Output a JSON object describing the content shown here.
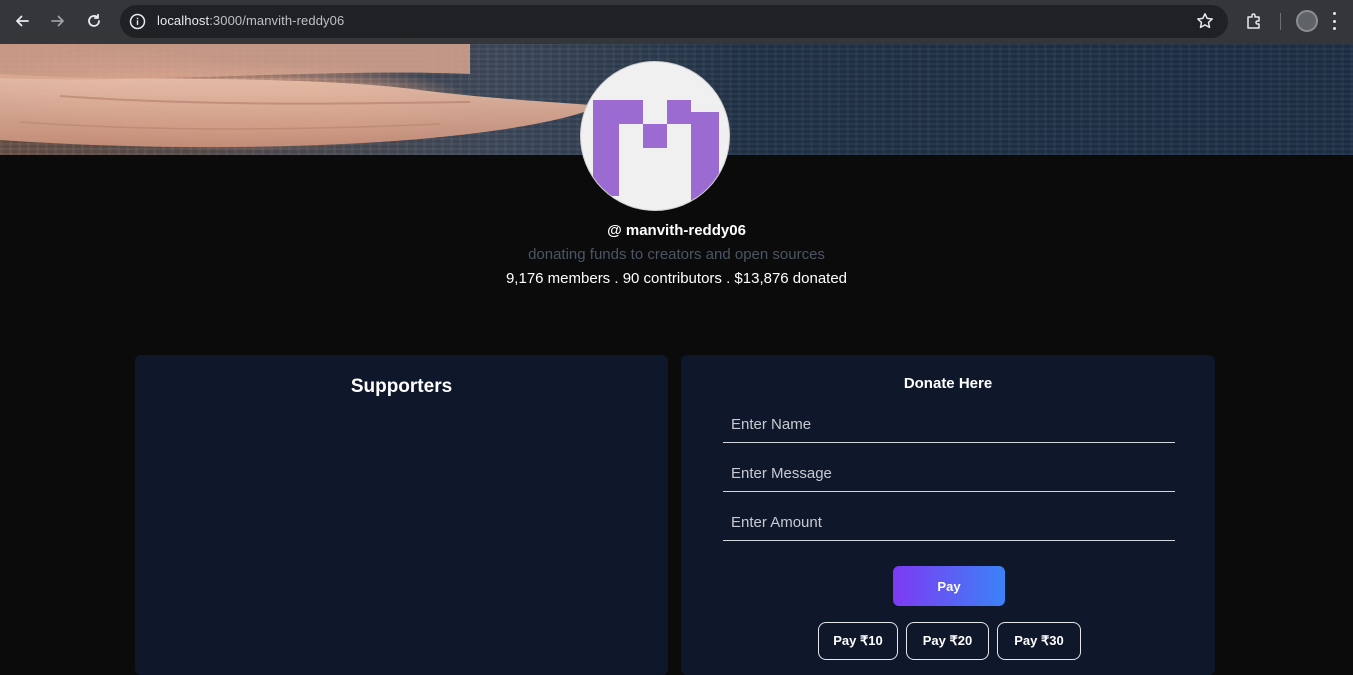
{
  "browser": {
    "url_host": "localhost",
    "url_path": ":3000/manvith-reddy06"
  },
  "profile": {
    "handle": "@ manvith-reddy06",
    "description": "donating funds to creators and open sources",
    "stats": "9,176 members . 90 contributors . $13,876 donated",
    "avatar_color": "#9b6bd1"
  },
  "supporters": {
    "title": "Supporters"
  },
  "donate": {
    "title": "Donate Here",
    "name_placeholder": "Enter Name",
    "message_placeholder": "Enter Message",
    "amount_placeholder": "Enter Amount",
    "pay_label": "Pay",
    "quick_amounts": [
      "Pay ₹10",
      "Pay ₹20",
      "Pay ₹30"
    ]
  },
  "colors": {
    "page_bg": "#0b0b0c",
    "panel_bg": "#0f172a",
    "pay_gradient_start": "#7e3af2",
    "pay_gradient_end": "#3b82f6"
  }
}
